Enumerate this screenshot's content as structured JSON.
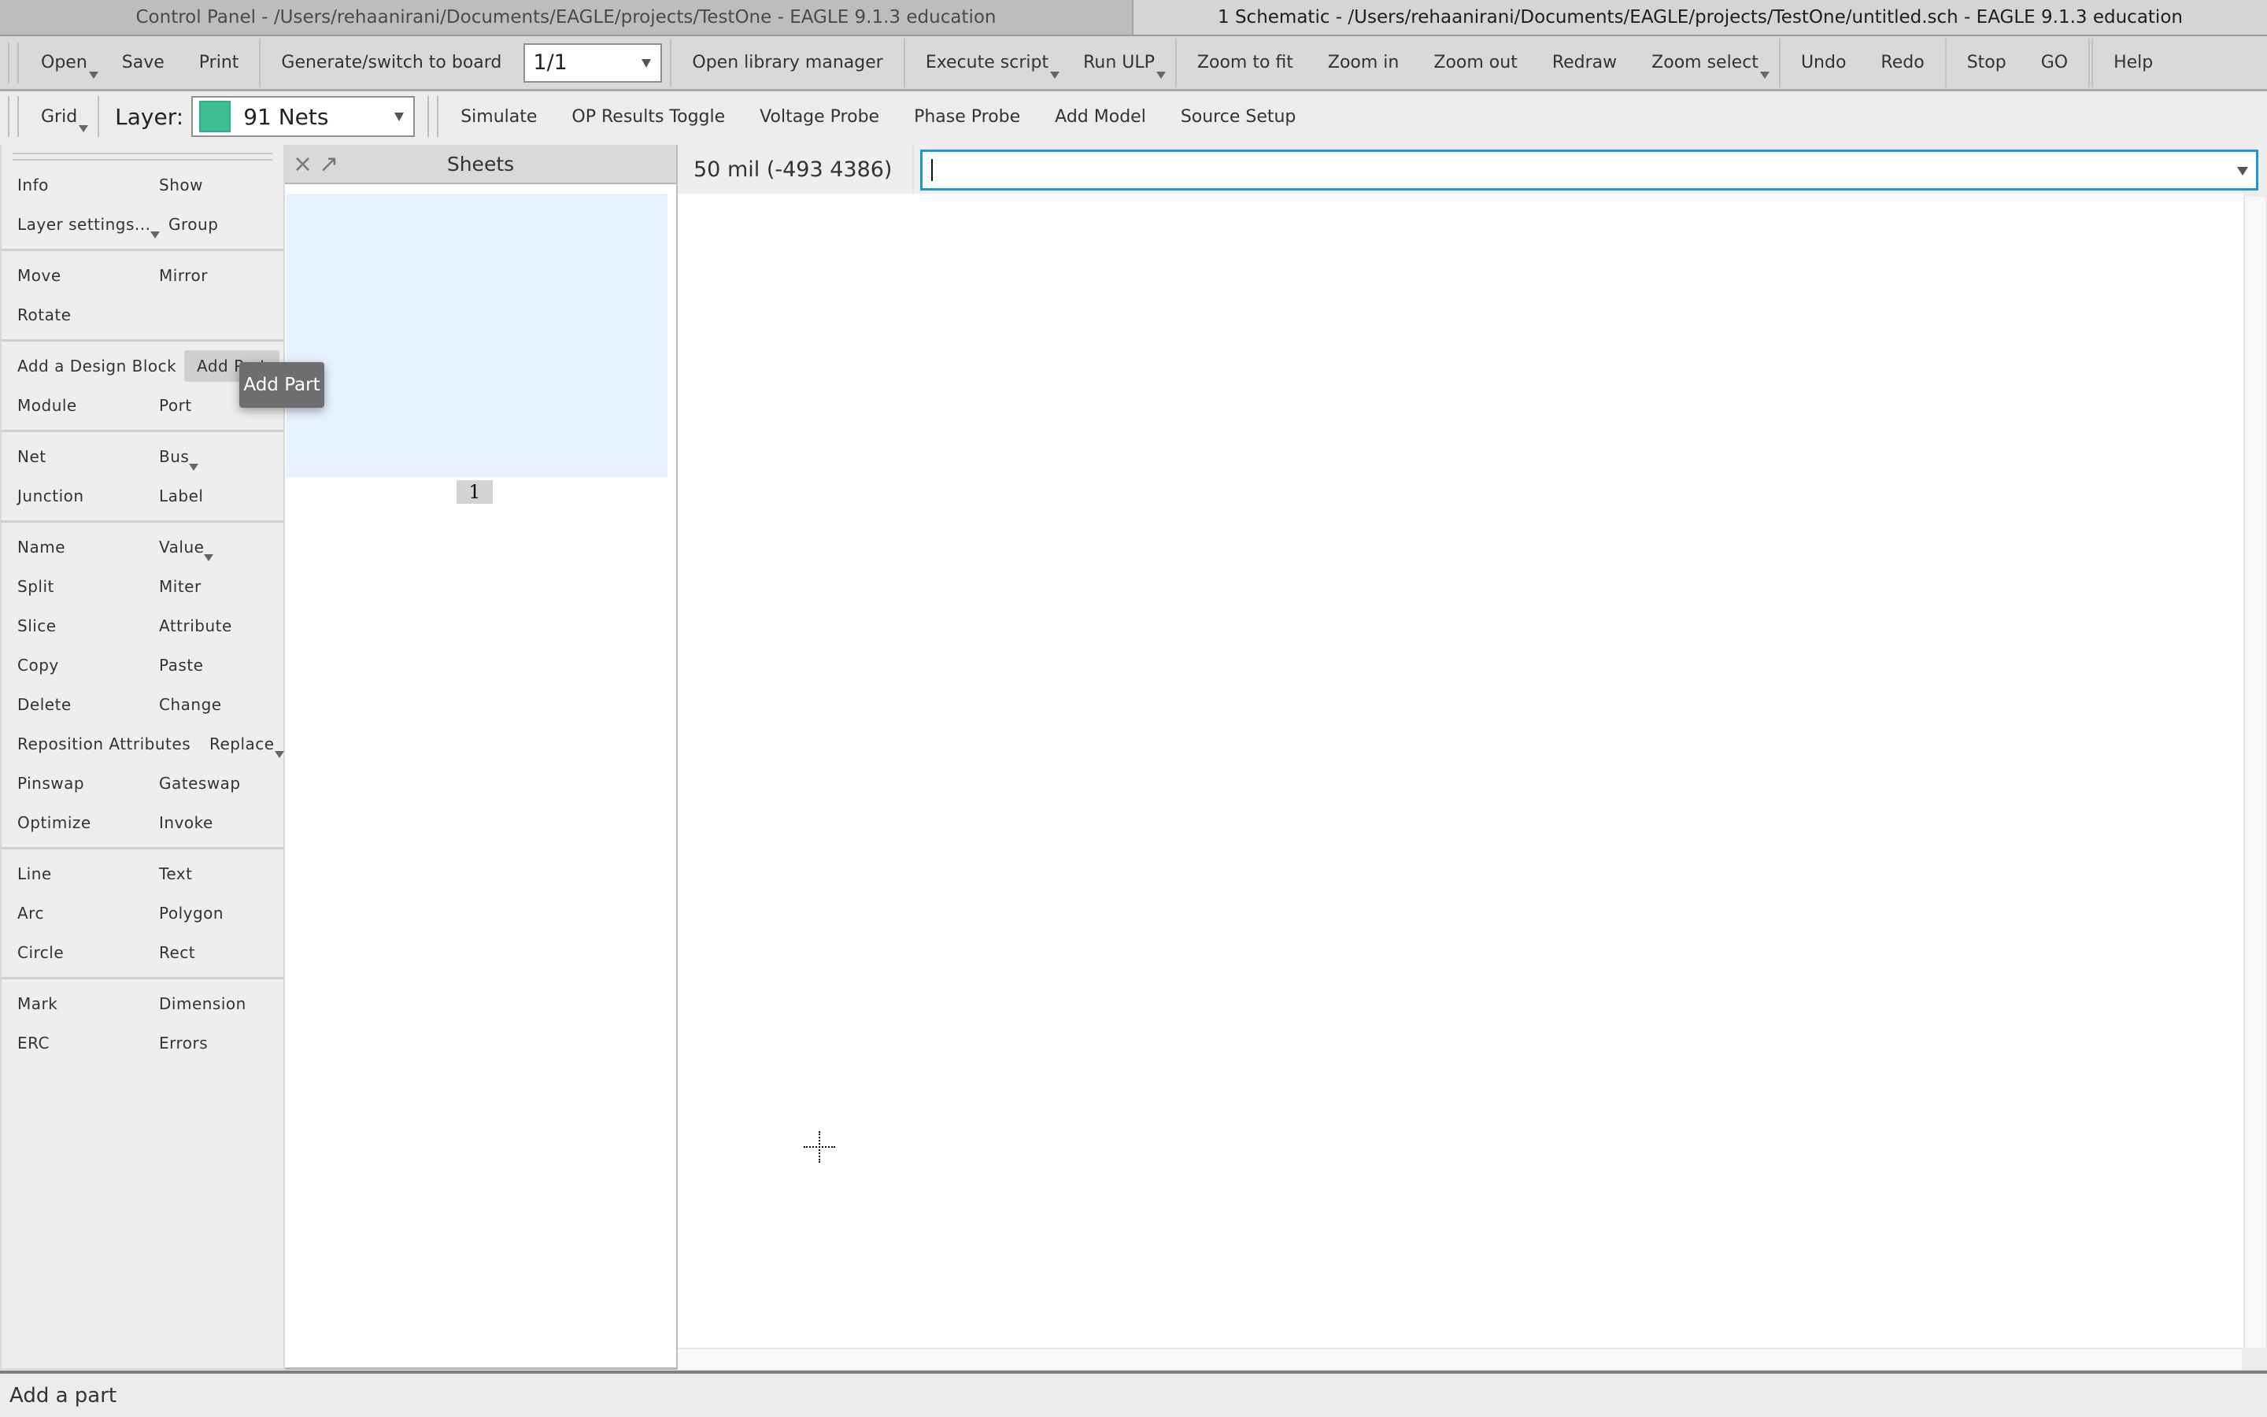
{
  "window_tabs": [
    {
      "label": "Control Panel - /Users/rehaanirani/Documents/EAGLE/projects/TestOne - EAGLE 9.1.3 education",
      "active": false
    },
    {
      "label": "1 Schematic - /Users/rehaanirani/Documents/EAGLE/projects/TestOne/untitled.sch - EAGLE 9.1.3 education",
      "active": true
    }
  ],
  "toolbar1": {
    "open": "Open",
    "save": "Save",
    "print": "Print",
    "generate_board": "Generate/switch to board",
    "sheet_select": "1/1",
    "open_library_manager": "Open library manager",
    "execute_script": "Execute script",
    "run_ulp": "Run ULP",
    "zoom_to_fit": "Zoom to fit",
    "zoom_in": "Zoom in",
    "zoom_out": "Zoom out",
    "redraw": "Redraw",
    "zoom_select": "Zoom select",
    "undo": "Undo",
    "redo": "Redo",
    "stop": "Stop",
    "go": "GO",
    "help": "Help"
  },
  "toolbar2": {
    "grid": "Grid",
    "layer_label": "Layer:",
    "layer_value": "91 Nets",
    "layer_color": "#3dbd93",
    "simulate": "Simulate",
    "op_results_toggle": "OP Results Toggle",
    "voltage_probe": "Voltage Probe",
    "phase_probe": "Phase Probe",
    "add_model": "Add Model",
    "source_setup": "Source Setup"
  },
  "command_panel": {
    "groups": [
      [
        [
          "Info",
          "Show"
        ],
        [
          "Layer settings...",
          "Group"
        ]
      ],
      [
        [
          "Move",
          "Mirror"
        ],
        [
          "Rotate",
          ""
        ]
      ],
      [
        [
          "Add a Design Block",
          "Add Part"
        ],
        [
          "Module",
          "Port"
        ]
      ],
      [
        [
          "Net",
          "Bus"
        ],
        [
          "Junction",
          "Label"
        ]
      ],
      [
        [
          "Name",
          "Value"
        ],
        [
          "Split",
          "Miter"
        ],
        [
          "Slice",
          "Attribute"
        ],
        [
          "Copy",
          "Paste"
        ],
        [
          "Delete",
          "Change"
        ],
        [
          "Reposition Attributes",
          "Replace"
        ],
        [
          "Pinswap",
          "Gateswap"
        ],
        [
          "Optimize",
          "Invoke"
        ]
      ],
      [
        [
          "Line",
          "Text"
        ],
        [
          "Arc",
          "Polygon"
        ],
        [
          "Circle",
          "Rect"
        ]
      ],
      [
        [
          "Mark",
          "Dimension"
        ],
        [
          "ERC",
          "Errors"
        ]
      ]
    ],
    "tooltip": "Add Part"
  },
  "sheets_panel": {
    "title": "Sheets",
    "close_icon": "×",
    "float_icon": "↗",
    "sheets": [
      "1"
    ]
  },
  "command_bar": {
    "coordinates": "50 mil (-493 4386)",
    "input_value": ""
  },
  "status_bar": {
    "message": "Add a part"
  },
  "colors": {
    "accent": "#1a96d9",
    "sheet_thumb": "#e6f2fd"
  }
}
